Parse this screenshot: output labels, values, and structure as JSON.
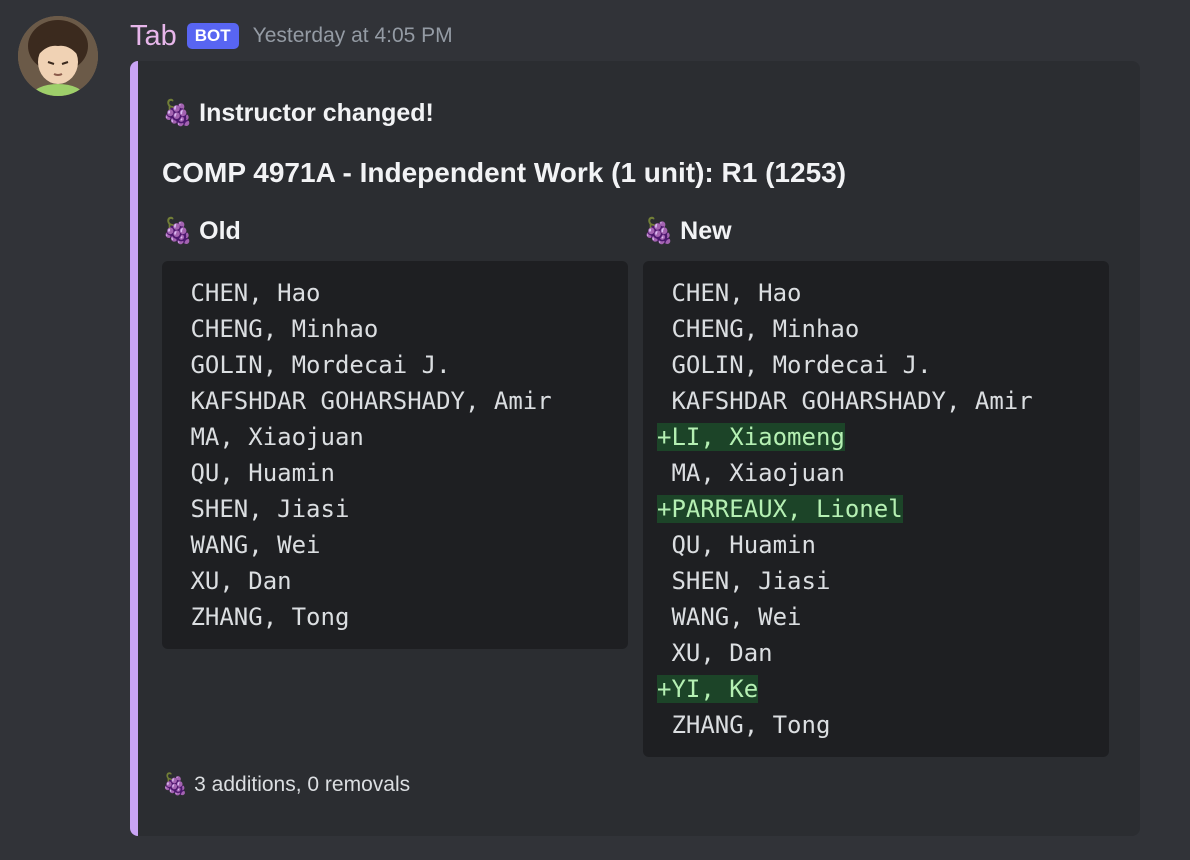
{
  "author": {
    "username": "Tab",
    "bot_tag": "BOT",
    "timestamp": "Yesterday at 4:05 PM"
  },
  "embed": {
    "accent_color": "#c9a4f4",
    "author_emoji": "🍇",
    "author_text": "Instructor changed!",
    "title": "COMP 4971A - Independent Work (1 unit): R1 (1253)",
    "fields": {
      "old": {
        "emoji": "🍇",
        "name": "Old",
        "lines": [
          " CHEN, Hao",
          " CHENG, Minhao",
          " GOLIN, Mordecai J.",
          " KAFSHDAR GOHARSHADY, Amir",
          " MA, Xiaojuan",
          " QU, Huamin",
          " SHEN, Jiasi",
          " WANG, Wei",
          " XU, Dan",
          " ZHANG, Tong"
        ]
      },
      "new": {
        "emoji": "🍇",
        "name": "New",
        "lines": [
          " CHEN, Hao",
          " CHENG, Minhao",
          " GOLIN, Mordecai J.",
          " KAFSHDAR GOHARSHADY, Amir",
          "+LI, Xiaomeng",
          " MA, Xiaojuan",
          "+PARREAUX, Lionel",
          " QU, Huamin",
          " SHEN, Jiasi",
          " WANG, Wei",
          " XU, Dan",
          "+YI, Ke",
          " ZHANG, Tong"
        ]
      }
    },
    "footer_emoji": "🍇",
    "footer_text": "3 additions, 0 removals"
  }
}
